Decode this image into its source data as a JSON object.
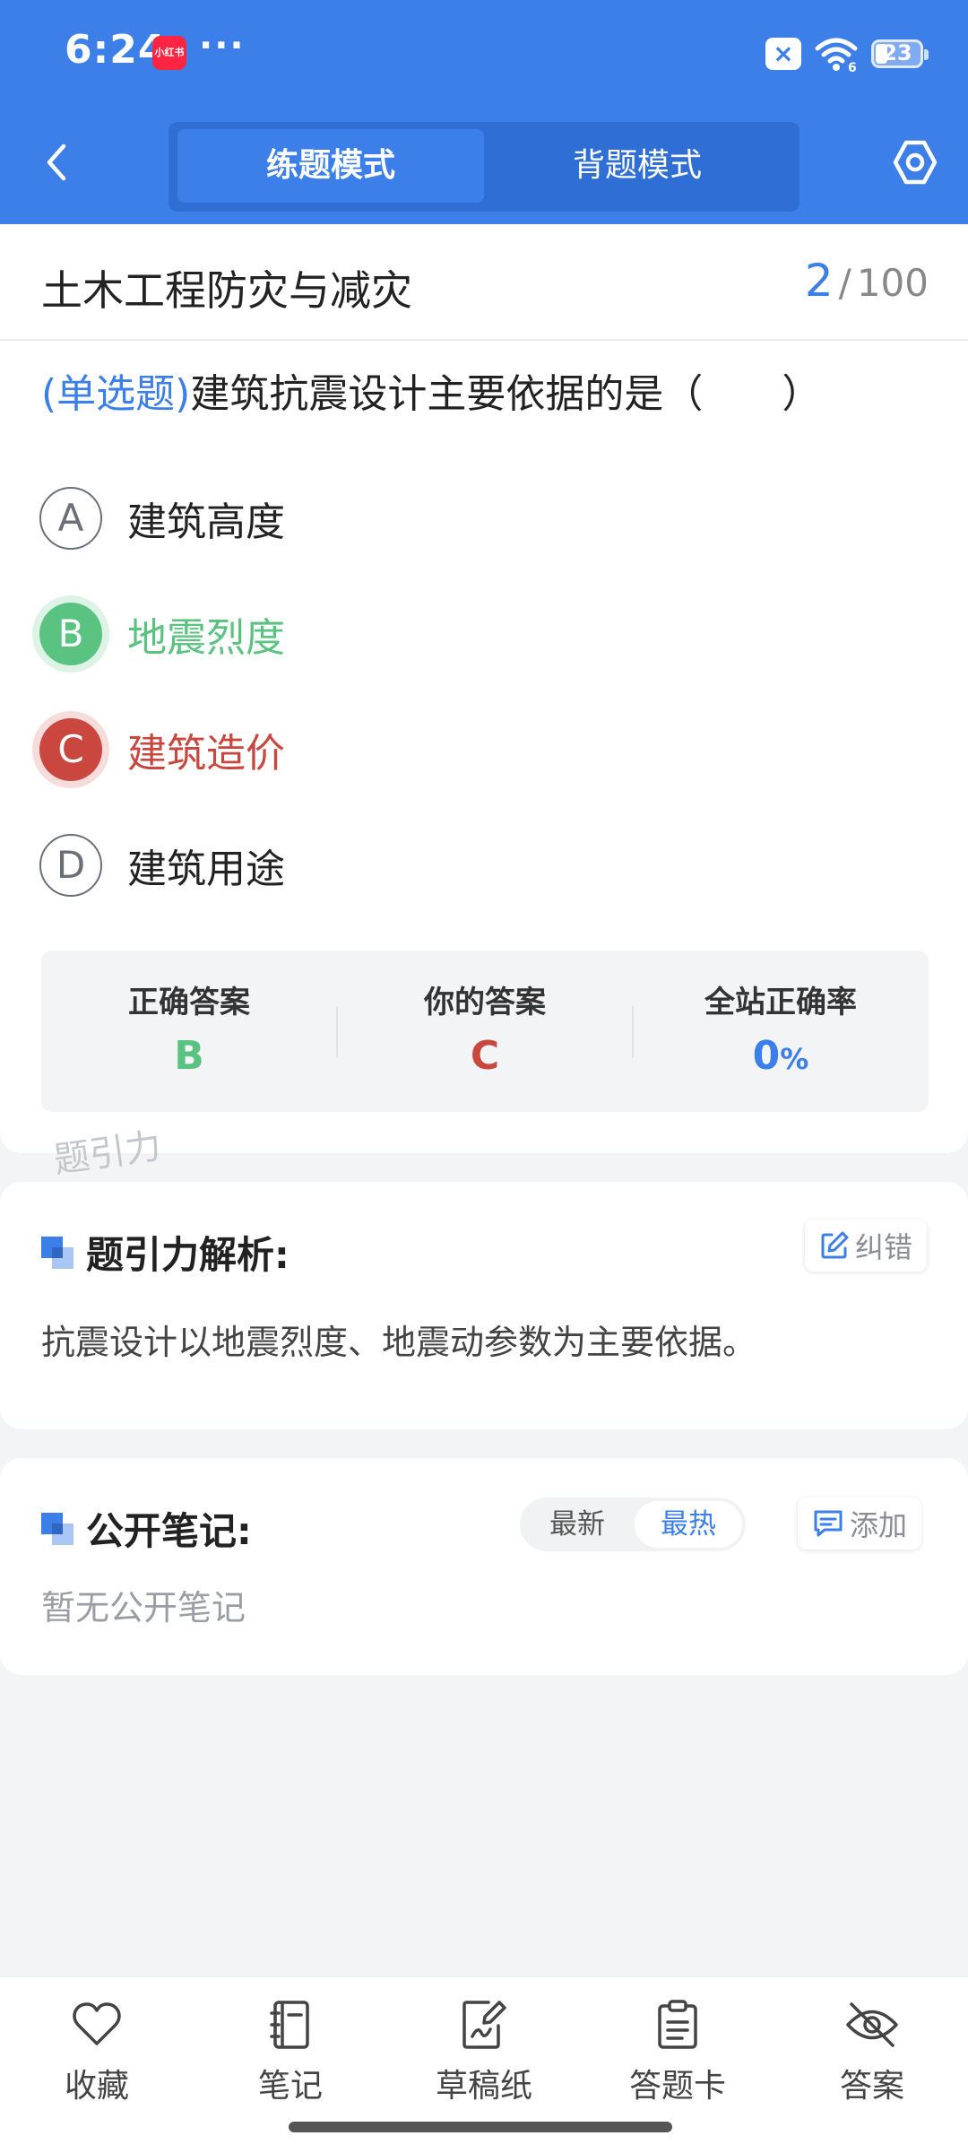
{
  "status_bar": {
    "time": "6:24",
    "app_badge": "小红书",
    "dots": "···",
    "battery_level": "23"
  },
  "nav": {
    "mode_practice": "练题模式",
    "mode_memorize": "背题模式"
  },
  "question": {
    "subject": "土木工程防灾与减灾",
    "current": "2",
    "separator": "/",
    "total": "100",
    "type_label": "(单选题)",
    "text": "建筑抗震设计主要依据的是（　　）",
    "options": [
      {
        "letter": "A",
        "text": "建筑高度",
        "state": "normal"
      },
      {
        "letter": "B",
        "text": "地震烈度",
        "state": "correct"
      },
      {
        "letter": "C",
        "text": "建筑造价",
        "state": "wrong"
      },
      {
        "letter": "D",
        "text": "建筑用途",
        "state": "normal"
      }
    ]
  },
  "answers": {
    "correct_label": "正确答案",
    "correct_value": "B",
    "yours_label": "你的答案",
    "yours_value": "C",
    "rate_label": "全站正确率",
    "rate_value": "0",
    "rate_unit": "%"
  },
  "watermark": "题引力",
  "analysis": {
    "title": "题引力解析:",
    "report_button": "纠错",
    "text": "抗震设计以地震烈度、地震动参数为主要依据。"
  },
  "notes": {
    "title": "公开笔记:",
    "sort_latest": "最新",
    "sort_hot": "最热",
    "add_button": "添加",
    "empty_text": "暂无公开笔记"
  },
  "bottom_bar": {
    "favorite": "收藏",
    "notes": "笔记",
    "scratch": "草稿纸",
    "answer_card": "答题卡",
    "answer": "答案"
  },
  "colors": {
    "primary": "#3C7FE8",
    "correct": "#5BC381",
    "wrong": "#C9473F"
  }
}
